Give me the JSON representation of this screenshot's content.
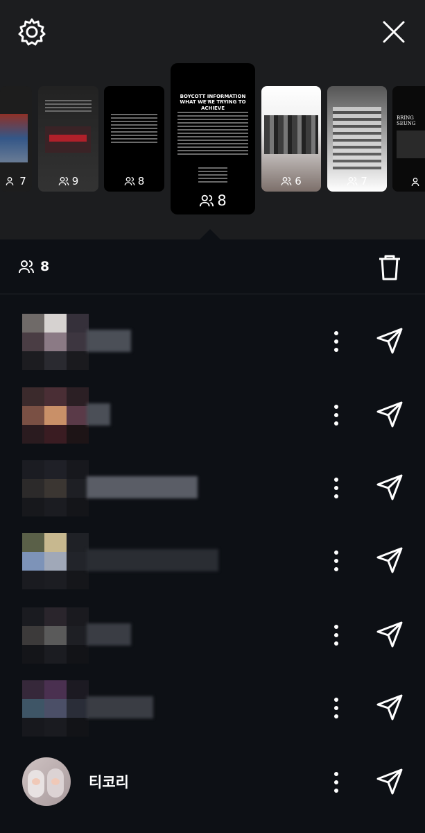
{
  "topbar": {
    "settings_icon": "gear-icon",
    "close_icon": "close-icon"
  },
  "stories": [
    {
      "count": "7"
    },
    {
      "count": "9"
    },
    {
      "count": "8"
    },
    {
      "count": "8",
      "selected": true,
      "title": "BOYCOTT INFORMATION\nWHAT WE'RE TRYING TO ACHIEVE"
    },
    {
      "count": "6"
    },
    {
      "count": "7"
    },
    {
      "count": "",
      "title": "BRING SEUNG"
    }
  ],
  "header": {
    "viewers_count": "8",
    "delete_icon": "trash-icon"
  },
  "viewers": [
    {
      "name": ""
    },
    {
      "name": ""
    },
    {
      "name": ""
    },
    {
      "name": ""
    },
    {
      "name": ""
    },
    {
      "name": ""
    },
    {
      "name": "티코리"
    }
  ],
  "colors": {
    "background": "#0d1015",
    "topbar": "#1c1d1f",
    "text": "#ffffff"
  }
}
